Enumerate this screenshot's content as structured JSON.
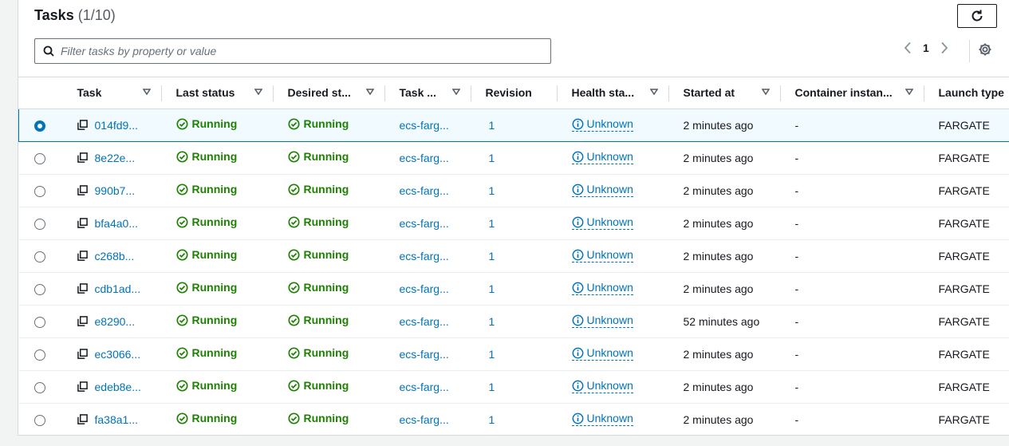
{
  "panel": {
    "title": "Tasks",
    "count": "(1/10)",
    "search_placeholder": "Filter tasks by property or value",
    "page_number": "1"
  },
  "columns": [
    "Task",
    "Last status",
    "Desired st...",
    "Task ...",
    "Revision",
    "Health sta...",
    "Started at",
    "Container instan...",
    "Launch type"
  ],
  "rows": [
    {
      "task": "014fd9...",
      "last_status": "Running",
      "desired_status": "Running",
      "task_def": "ecs-farg...",
      "revision": "1",
      "health": "Unknown",
      "started": "2 minutes ago",
      "container": "-",
      "launch": "FARGATE",
      "selected": true
    },
    {
      "task": "8e22e...",
      "last_status": "Running",
      "desired_status": "Running",
      "task_def": "ecs-farg...",
      "revision": "1",
      "health": "Unknown",
      "started": "2 minutes ago",
      "container": "-",
      "launch": "FARGATE",
      "selected": false
    },
    {
      "task": "990b7...",
      "last_status": "Running",
      "desired_status": "Running",
      "task_def": "ecs-farg...",
      "revision": "1",
      "health": "Unknown",
      "started": "2 minutes ago",
      "container": "-",
      "launch": "FARGATE",
      "selected": false
    },
    {
      "task": "bfa4a0...",
      "last_status": "Running",
      "desired_status": "Running",
      "task_def": "ecs-farg...",
      "revision": "1",
      "health": "Unknown",
      "started": "2 minutes ago",
      "container": "-",
      "launch": "FARGATE",
      "selected": false
    },
    {
      "task": "c268b...",
      "last_status": "Running",
      "desired_status": "Running",
      "task_def": "ecs-farg...",
      "revision": "1",
      "health": "Unknown",
      "started": "2 minutes ago",
      "container": "-",
      "launch": "FARGATE",
      "selected": false
    },
    {
      "task": "cdb1ad...",
      "last_status": "Running",
      "desired_status": "Running",
      "task_def": "ecs-farg...",
      "revision": "1",
      "health": "Unknown",
      "started": "2 minutes ago",
      "container": "-",
      "launch": "FARGATE",
      "selected": false
    },
    {
      "task": "e8290...",
      "last_status": "Running",
      "desired_status": "Running",
      "task_def": "ecs-farg...",
      "revision": "1",
      "health": "Unknown",
      "started": "52 minutes ago",
      "container": "-",
      "launch": "FARGATE",
      "selected": false
    },
    {
      "task": "ec3066...",
      "last_status": "Running",
      "desired_status": "Running",
      "task_def": "ecs-farg...",
      "revision": "1",
      "health": "Unknown",
      "started": "2 minutes ago",
      "container": "-",
      "launch": "FARGATE",
      "selected": false
    },
    {
      "task": "edeb8e...",
      "last_status": "Running",
      "desired_status": "Running",
      "task_def": "ecs-farg...",
      "revision": "1",
      "health": "Unknown",
      "started": "2 minutes ago",
      "container": "-",
      "launch": "FARGATE",
      "selected": false
    },
    {
      "task": "fa38a1...",
      "last_status": "Running",
      "desired_status": "Running",
      "task_def": "ecs-farg...",
      "revision": "1",
      "health": "Unknown",
      "started": "2 minutes ago",
      "container": "-",
      "launch": "FARGATE",
      "selected": false
    }
  ],
  "colors": {
    "link": "#0073bb",
    "success": "#1d8102",
    "selected_bg": "#f1faff"
  }
}
